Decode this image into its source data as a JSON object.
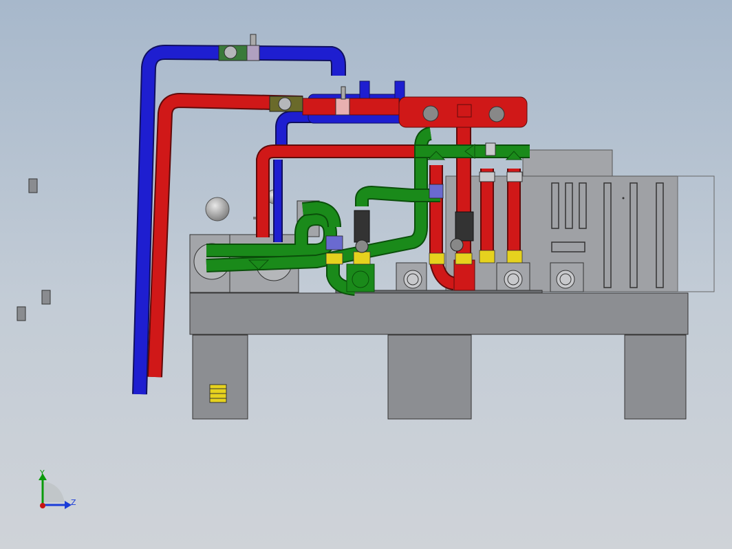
{
  "viewport": {
    "background": "#b8c4d0",
    "colors": {
      "supply_blue": "#1414c8",
      "return_red": "#c81414",
      "glycol_green": "#117a11",
      "frame_gray": "#8c8e92",
      "pump_gray": "#a3a5a9",
      "band_yellow": "#e6d21e",
      "flex_black": "#333333"
    }
  },
  "triad": {
    "y_label": "Y",
    "z_label": "Z",
    "y_color": "#0a9a0a",
    "z_color": "#1a3cd8",
    "x_color": "#c81414"
  }
}
